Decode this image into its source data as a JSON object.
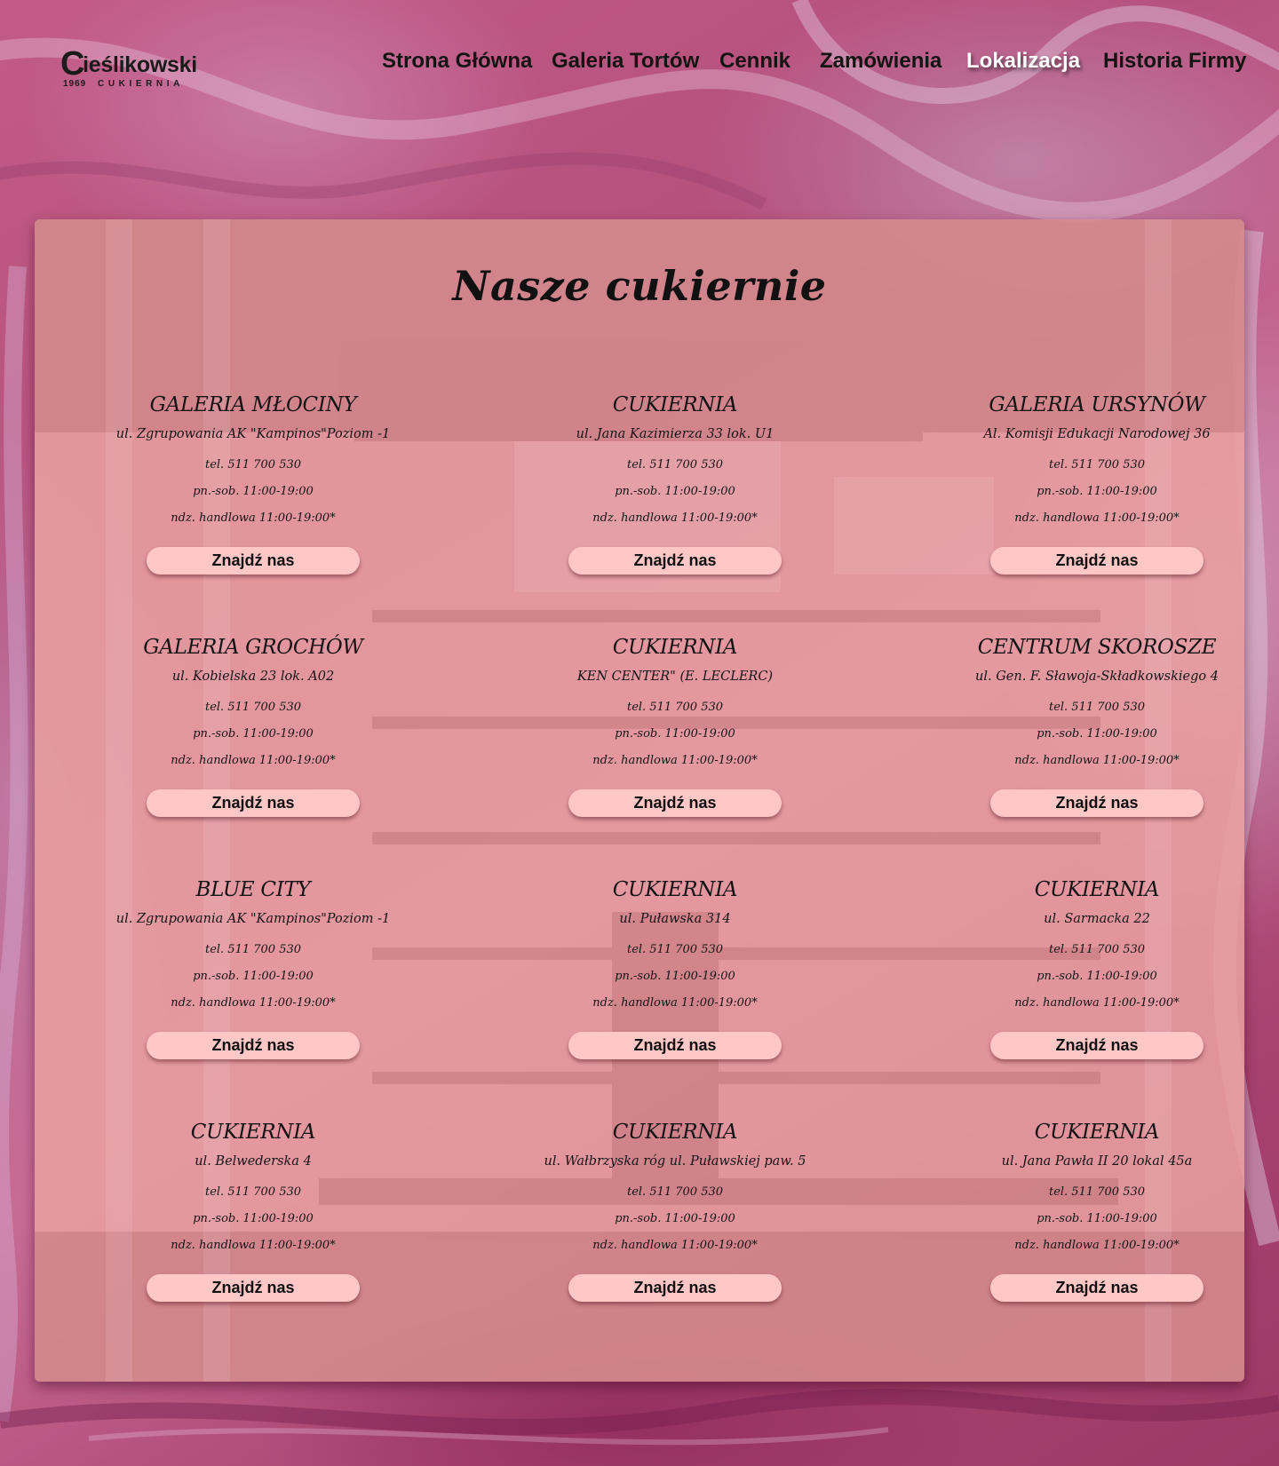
{
  "brand": {
    "initial": "C",
    "rest": "ieślikowski",
    "year": "1969",
    "subtitle": "CUKIERNIA"
  },
  "nav": {
    "items": [
      {
        "label": "Strona Główna"
      },
      {
        "label": "Galeria Tortów"
      },
      {
        "label": "Cennik"
      },
      {
        "label": "Zamówienia"
      },
      {
        "label": "Lokalizacja",
        "active": true
      },
      {
        "label": "Historia Firmy"
      }
    ]
  },
  "page": {
    "title": "Nasze cukiernie",
    "find_label": "Znajdź nas"
  },
  "locations": [
    {
      "name": "GALERIA MŁOCINY",
      "address": "ul. Zgrupowania AK \"Kampinos\"Poziom -1",
      "phone": "tel. 511 700 530",
      "hours": "pn.-sob. 11:00-19:00",
      "sunday": "ndz. handlowa 11:00-19:00*"
    },
    {
      "name": "CUKIERNIA",
      "address": "ul. Jana Kazimierza 33 lok. U1",
      "phone": "tel. 511 700 530",
      "hours": "pn.-sob. 11:00-19:00",
      "sunday": "ndz. handlowa 11:00-19:00*"
    },
    {
      "name": "GALERIA URSYNÓW",
      "address": "Al. Komisji Edukacji Narodowej 36",
      "phone": "tel. 511 700 530",
      "hours": "pn.-sob. 11:00-19:00",
      "sunday": "ndz. handlowa 11:00-19:00*"
    },
    {
      "name": "GALERIA GROCHÓW",
      "address": "ul. Kobielska 23 lok. A02",
      "phone": "tel. 511 700 530",
      "hours": "pn.-sob. 11:00-19:00",
      "sunday": "ndz. handlowa 11:00-19:00*"
    },
    {
      "name": "CUKIERNIA",
      "address": "KEN CENTER\" (E. LECLERC)",
      "phone": "tel. 511 700 530",
      "hours": "pn.-sob. 11:00-19:00",
      "sunday": "ndz. handlowa 11:00-19:00*"
    },
    {
      "name": "CENTRUM SKOROSZE",
      "address": "ul. Gen. F. Sławoja-Składkowskiego 4",
      "phone": "tel. 511 700 530",
      "hours": "pn.-sob. 11:00-19:00",
      "sunday": "ndz. handlowa 11:00-19:00*"
    },
    {
      "name": "BLUE CITY",
      "address": "ul. Zgrupowania AK \"Kampinos\"Poziom -1",
      "phone": "tel. 511 700 530",
      "hours": "pn.-sob. 11:00-19:00",
      "sunday": "ndz. handlowa 11:00-19:00*"
    },
    {
      "name": "CUKIERNIA",
      "address": "ul. Puławska 314",
      "phone": "tel. 511 700 530",
      "hours": "pn.-sob. 11:00-19:00",
      "sunday": "ndz. handlowa 11:00-19:00*"
    },
    {
      "name": "CUKIERNIA",
      "address": "ul. Sarmacka 22",
      "phone": "tel. 511 700 530",
      "hours": "pn.-sob. 11:00-19:00",
      "sunday": "ndz. handlowa 11:00-19:00*"
    },
    {
      "name": "CUKIERNIA",
      "address": "ul. Belwederska 4",
      "phone": "tel. 511 700 530",
      "hours": "pn.-sob. 11:00-19:00",
      "sunday": "ndz. handlowa 11:00-19:00*"
    },
    {
      "name": "CUKIERNIA",
      "address": "ul. Wałbrzyska róg ul. Puławskiej paw. 5",
      "phone": "tel. 511 700 530",
      "hours": "pn.-sob. 11:00-19:00",
      "sunday": "ndz. handlowa 11:00-19:00*"
    },
    {
      "name": "CUKIERNIA",
      "address": "ul. Jana Pawła II 20 lokal 45a",
      "phone": "tel. 511 700 530",
      "hours": "pn.-sob. 11:00-19:00",
      "sunday": "ndz. handlowa 11:00-19:00*"
    }
  ],
  "colors": {
    "background": "#b5507c",
    "panel": "#e89ea0",
    "button": "#ffc7c6",
    "text": "#151515",
    "active_nav": "#ffffff"
  }
}
